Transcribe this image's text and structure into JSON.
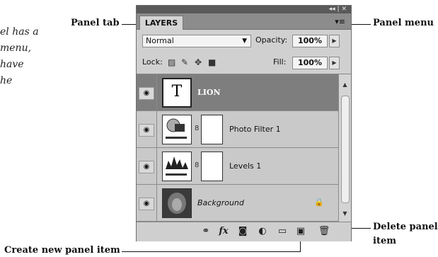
{
  "caption_left": [
    "el has a",
    "menu,",
    "have",
    "he"
  ],
  "callouts": {
    "panel_tab": "Panel tab",
    "panel_menu": "Panel menu",
    "delete_item_line1": "Delete panel",
    "delete_item_line2": "item",
    "create_item": "Create new panel item"
  },
  "panel": {
    "title_controls": "◂◂ | ✕",
    "tab_label": "LAYERS",
    "blend_mode": "Normal",
    "opacity_label": "Opacity:",
    "opacity_value": "100%",
    "lock_label": "Lock:",
    "fill_label": "Fill:",
    "fill_value": "100%"
  },
  "layers": [
    {
      "name": "LION",
      "type": "text",
      "thumb_glyph": "T",
      "selected": true
    },
    {
      "name": "Photo Filter 1",
      "type": "adjustment"
    },
    {
      "name": "Levels 1",
      "type": "adjustment"
    },
    {
      "name": "Background",
      "type": "image",
      "locked": true
    }
  ],
  "icons": {
    "eye": "eye-icon",
    "link": "link-layers-icon",
    "fx": "fx-icon",
    "mask": "layer-mask-icon",
    "adjust": "adjustment-layer-icon",
    "group": "group-folder-icon",
    "new": "new-layer-icon",
    "trash": "trash-icon"
  },
  "colors": {
    "selected_row": "#7e7e7e",
    "panel_bg": "#bdbdbd",
    "titlebar": "#5a5a5a"
  }
}
